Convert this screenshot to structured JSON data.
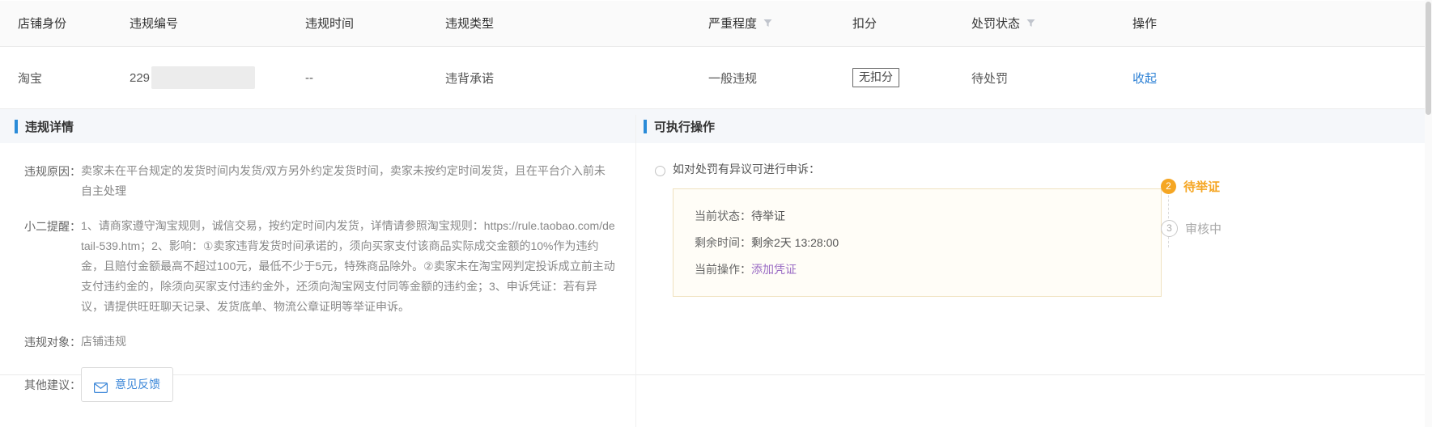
{
  "table": {
    "columns": [
      {
        "label": "店铺身份",
        "filter": false
      },
      {
        "label": "违规编号",
        "filter": false
      },
      {
        "label": "违规时间",
        "filter": false
      },
      {
        "label": "违规类型",
        "filter": false
      },
      {
        "label": "严重程度",
        "filter": true
      },
      {
        "label": "扣分",
        "filter": false
      },
      {
        "label": "处罚状态",
        "filter": true
      },
      {
        "label": "操作",
        "filter": false
      }
    ],
    "row": {
      "shop_identity": "淘宝",
      "violation_id_prefix": "229",
      "violation_id_masked": true,
      "violation_time": "--",
      "violation_type": "违背承诺",
      "severity": "一般违规",
      "deduction": "无扣分",
      "punish_status": "待处罚",
      "action_label": "收起"
    }
  },
  "detail": {
    "left_panel": {
      "title": "违规详情",
      "reason_label": "违规原因：",
      "reason_value": "卖家未在平台规定的发货时间内发货/双方另外约定发货时间，卖家未按约定时间发货，且在平台介入前未自主处理",
      "tip_label": "小二提醒：",
      "tip_value": "1、请商家遵守淘宝规则，诚信交易，按约定时间内发货，详情请参照淘宝规则：https://rule.taobao.com/detail-539.htm；2、影响：①卖家违背发货时间承诺的，须向买家支付该商品实际成交金额的10%作为违约金，且赔付金额最高不超过100元，最低不少于5元，特殊商品除外。②卖家未在淘宝网判定投诉成立前主动支付违约金的，除须向买家支付违约金外，还须向淘宝网支付同等金额的违约金；3、申诉凭证：若有异议，请提供旺旺聊天记录、发货底单、物流公章证明等举证申诉。",
      "object_label": "违规对象：",
      "object_value": "店铺违规",
      "suggestion_label": "其他建议：",
      "feedback_button": "意见反馈",
      "feedback_icon": "envelope-icon"
    },
    "right_panel": {
      "title": "可执行操作",
      "appeal_title": "如对处罚有异议可进行申诉：",
      "status_label": "当前状态：",
      "status_value": "待举证",
      "remaining_label": "剩余时间：",
      "remaining_value": "剩余2天 13:28:00",
      "operation_label": "当前操作：",
      "operation_link": "添加凭证",
      "timeline": [
        {
          "step": "2",
          "label": "待举证",
          "state": "active"
        },
        {
          "step": "3",
          "label": "审核中",
          "state": "idle"
        }
      ]
    }
  },
  "colors": {
    "accent_blue": "#2a8bd8",
    "link_blue": "#2a7fd4",
    "active_orange": "#f5a623",
    "link_purple": "#9a6bc4",
    "box_border": "#f0e2c0"
  }
}
